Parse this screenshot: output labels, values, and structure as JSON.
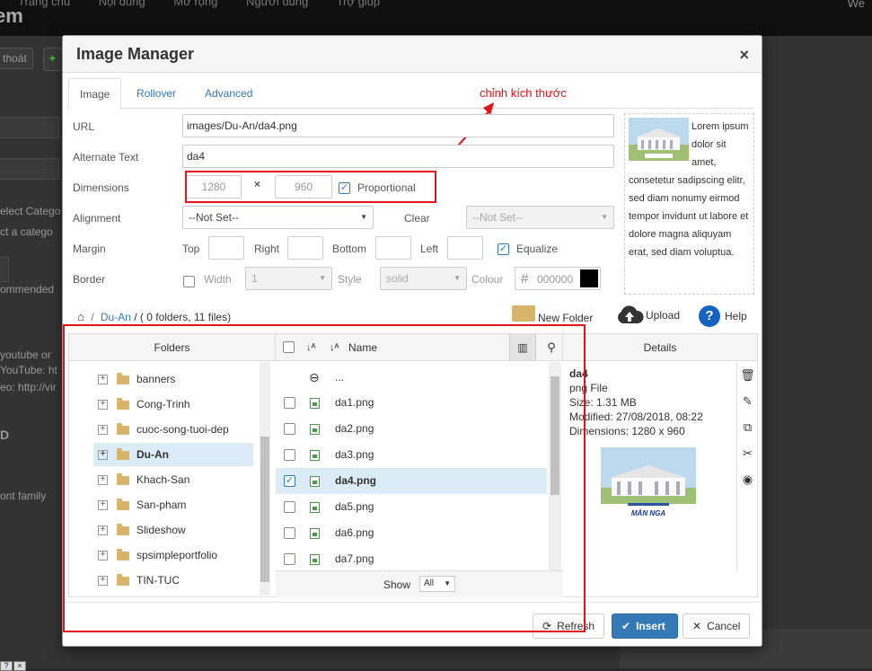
{
  "background": {
    "menu": [
      "Trang chủ",
      "Nội dung",
      "Mở rộng",
      "Người dùng",
      "Trợ giúp"
    ],
    "brand": "em",
    "top_right": "We",
    "exit_button": "thoát",
    "text_lines": [
      "elect Catego",
      "ct a catego",
      "ommended",
      "youtube or",
      "YouTube: ht",
      "eo: http://vir",
      "D",
      "ont family"
    ]
  },
  "dialog": {
    "title": "Image Manager",
    "close": "×",
    "tabs": [
      "Image",
      "Rollover",
      "Advanced"
    ],
    "annotation": "chỉnh kích thước"
  },
  "form": {
    "url_label": "URL",
    "url_value": "images/Du-An/da4.png",
    "alt_label": "Alternate Text",
    "alt_value": "da4",
    "dimensions_label": "Dimensions",
    "width_value": "1280",
    "times": "×",
    "height_value": "960",
    "proportional_label": "Proportional",
    "alignment_label": "Alignment",
    "alignment_value": "--Not Set--",
    "clear_label": "Clear",
    "clear_value": "--Not Set--",
    "margin_label": "Margin",
    "top_label": "Top",
    "right_label": "Right",
    "bottom_label": "Bottom",
    "left_label": "Left",
    "equalize_label": "Equalize",
    "border_label": "Border",
    "width_label": "Width",
    "border_width_value": "1",
    "style_label": "Style",
    "style_value": "solid",
    "colour_label": "Colour",
    "colour_hash": "#",
    "colour_value": "000000",
    "colour_hex": "#000000"
  },
  "preview_text": "Lorem ipsum dolor sit amet, consetetur sadipscing elitr, sed diam nonumy eirmod tempor invidunt ut labore et dolore magna aliquyam erat, sed diam voluptua.",
  "browser": {
    "breadcrumb_sep": "/",
    "breadcrumb_folder": "Du-An",
    "breadcrumb_info": "/ ( 0 folders, 11 files)",
    "new_folder": "New Folder",
    "upload": "Upload",
    "help": "Help",
    "folders_header": "Folders",
    "name_header": "Name",
    "details_header": "Details",
    "folders": [
      "banners",
      "Cong-Trinh",
      "cuoc-song-tuoi-dep",
      "Du-An",
      "Khach-San",
      "San-pham",
      "Slideshow",
      "spsimpleportfolio",
      "TIN-TUC"
    ],
    "up_item": "...",
    "files": [
      "da1.png",
      "da2.png",
      "da3.png",
      "da4.png",
      "da5.png",
      "da6.png",
      "da7.png"
    ],
    "show_label": "Show",
    "show_value": "All"
  },
  "details": {
    "name": "da4",
    "type": "png File",
    "size": "Size: 1.31 MB",
    "modified": "Modified: 27/08/2018, 08:22",
    "dimensions": "Dimensions: 1280 x 960",
    "thumb_caption": "MẪN NGA"
  },
  "footer": {
    "refresh": "Refresh",
    "insert": "Insert",
    "cancel": "Cancel"
  },
  "colors": {
    "annotation_red": "#e0141a",
    "primary_blue": "#337ab7",
    "selected_row": "#dcecf6"
  }
}
